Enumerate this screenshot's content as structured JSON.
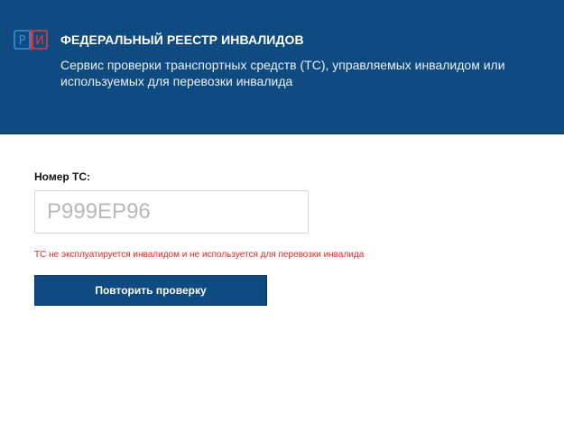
{
  "header": {
    "logo_letters": [
      "Р",
      "И"
    ],
    "title": "ФЕДЕРАЛЬНЫЙ РЕЕСТР ИНВАЛИДОВ",
    "subtitle": "Сервис проверки транспортных средств (ТС), управляемых инвалидом или используемых для перевозки инвалида"
  },
  "form": {
    "label": "Номер ТС:",
    "input_value": "Р999ЕР96",
    "error_message": "ТС не эксплуатируется инвалидом и не используется для перевозки инвалида",
    "retry_button": "Повторить проверку"
  },
  "colors": {
    "header_bg": "#0f4a80",
    "logo_blue": "#3a8fd6",
    "logo_red": "#e53a3a",
    "error": "#e32626"
  }
}
